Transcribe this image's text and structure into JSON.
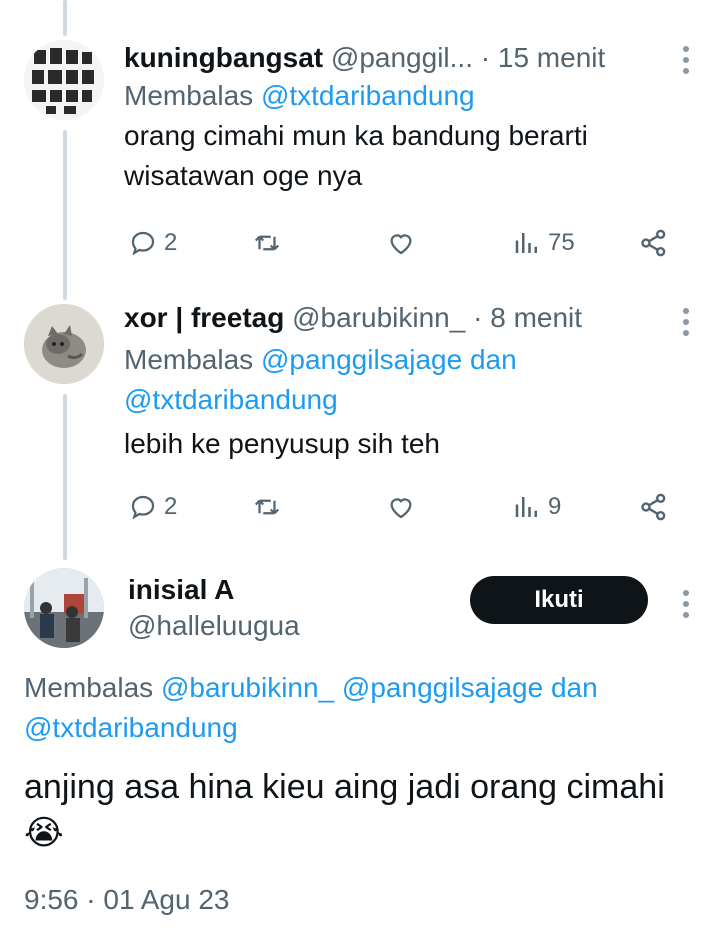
{
  "tweets": [
    {
      "name": "kuningbangsat",
      "handle": "@panggil...",
      "time": "· 15 menit",
      "replying_prefix": "Membalas",
      "replying_to": "@txtdaribandung",
      "text": "orang cimahi mun ka bandung berarti wisatawan oge nya",
      "replies": "2",
      "views": "75"
    },
    {
      "name": "xor | freetag",
      "handle": "@barubikinn_",
      "time": "· 8 menit",
      "replying_prefix": "Membalas",
      "replying_to_1": "@panggilsajage dan",
      "replying_to_2": "@txtdaribandung",
      "text": "lebih ke penyusup sih teh",
      "replies": "2",
      "views": "9"
    }
  ],
  "main_tweet": {
    "name": "inisial A",
    "handle": "@halleluugua",
    "follow_label": "Ikuti",
    "replying_prefix": "Membalas",
    "replying_to_1": "@barubikinn_ @panggilsajage dan",
    "replying_to_2": "@txtdaribandung",
    "text": "anjing asa hina kieu aing jadi orang cimahi",
    "emoji": "😭",
    "timestamp": "9:56 · 01 Agu 23"
  },
  "icons": [
    "reply-icon",
    "retweet-icon",
    "like-icon",
    "views-icon",
    "share-icon",
    "more-icon"
  ],
  "colors": {
    "accent": "#1d9bf0",
    "muted": "#536471",
    "text": "#0f1419",
    "button": "#0f1419"
  }
}
